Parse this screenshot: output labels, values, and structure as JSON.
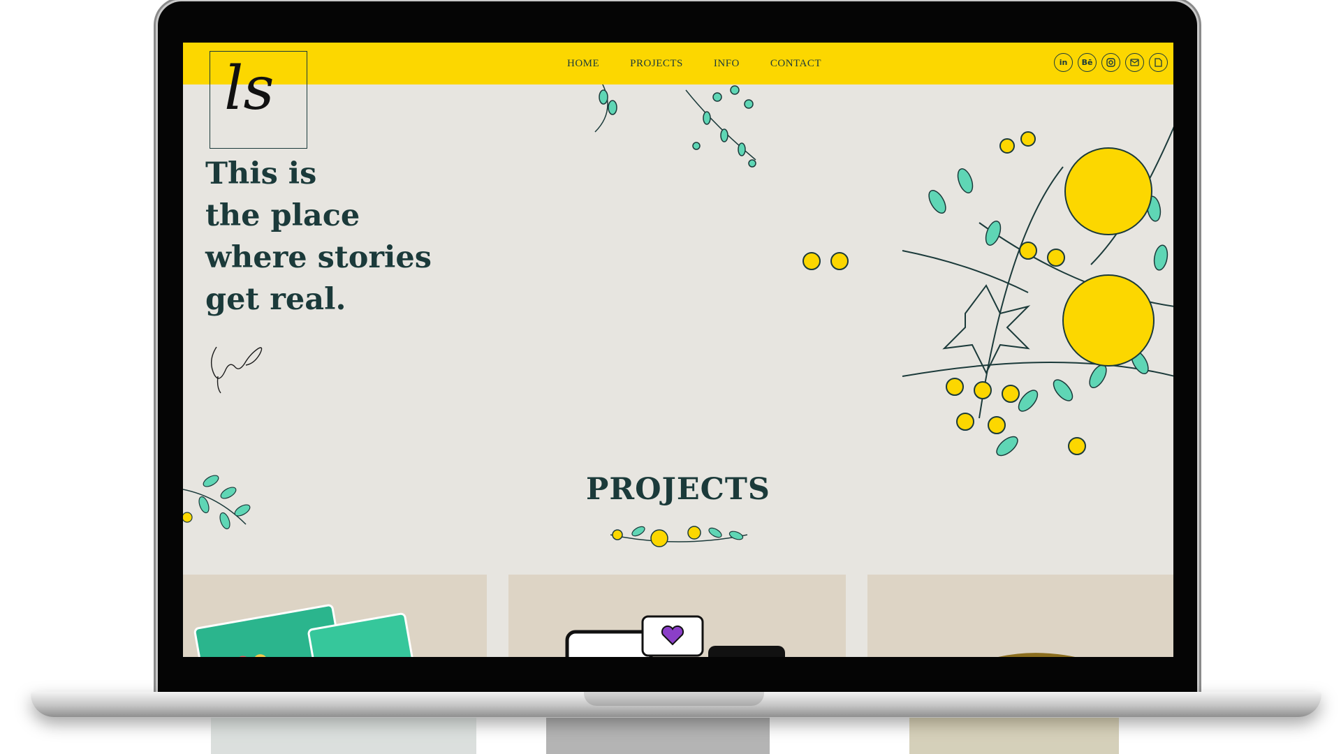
{
  "nav": {
    "links": [
      "HOME",
      "PROJECTS",
      "INFO",
      "CONTACT"
    ],
    "social_icons": [
      {
        "name": "linkedin-icon",
        "glyph": "in"
      },
      {
        "name": "behance-icon",
        "glyph": "Bē"
      },
      {
        "name": "instagram-icon",
        "glyph": ""
      },
      {
        "name": "mail-icon",
        "glyph": ""
      },
      {
        "name": "document-icon",
        "glyph": ""
      }
    ]
  },
  "logo": {
    "text": "ls"
  },
  "hero": {
    "lines": [
      "This is",
      "the place",
      "where stories",
      "get real."
    ]
  },
  "projects": {
    "heading": "PROJECTS"
  },
  "colors": {
    "accent_yellow": "#fcd700",
    "text_dark": "#1b3a3a",
    "background": "#e7e5e0",
    "card_bg": "#ddd4c5",
    "leaf_mint": "#5fd6b5"
  }
}
